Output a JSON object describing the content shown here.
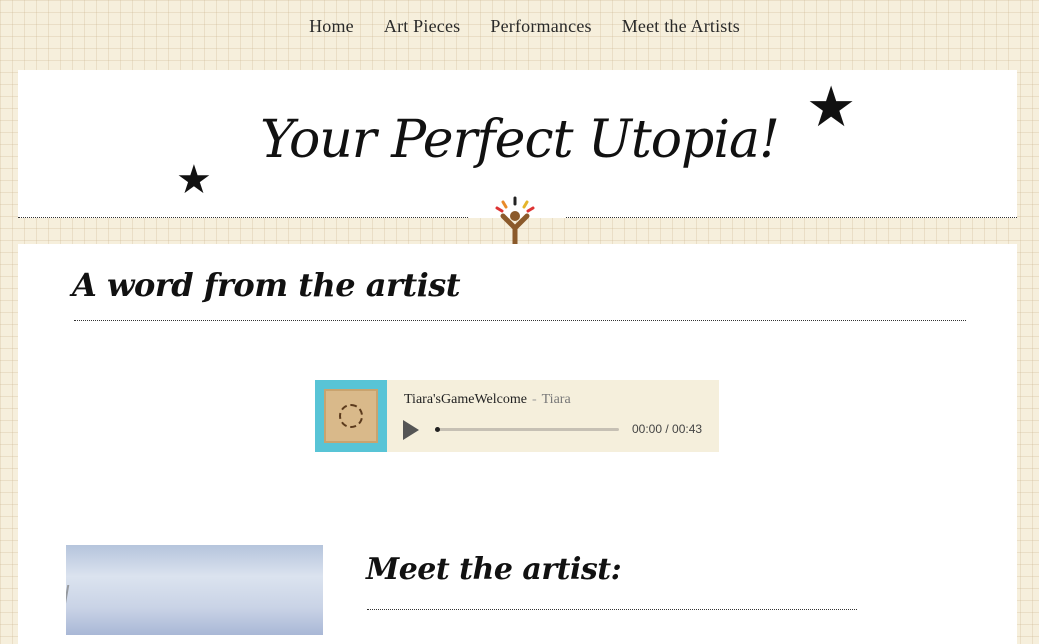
{
  "nav": {
    "items": [
      "Home",
      "Art Pieces",
      "Performances",
      "Meet the Artists"
    ]
  },
  "header": {
    "title": "Your Perfect Utopia!",
    "logo_icon": "tree-person-icon"
  },
  "sections": {
    "artist_word_heading": "A word from the artist",
    "meet_artist_heading": "Meet the artist:"
  },
  "audio_player": {
    "track_title": "Tiara'sGameWelcome",
    "separator": "-",
    "artist": "Tiara",
    "current_time": "00:00",
    "time_separator": " / ",
    "duration": "00:43",
    "progress": 0.0,
    "play_icon": "play-icon"
  },
  "colors": {
    "page_background": "#f6efdc",
    "panel_background": "#ffffff",
    "player_background": "#f5efdc",
    "text": "#222222"
  }
}
